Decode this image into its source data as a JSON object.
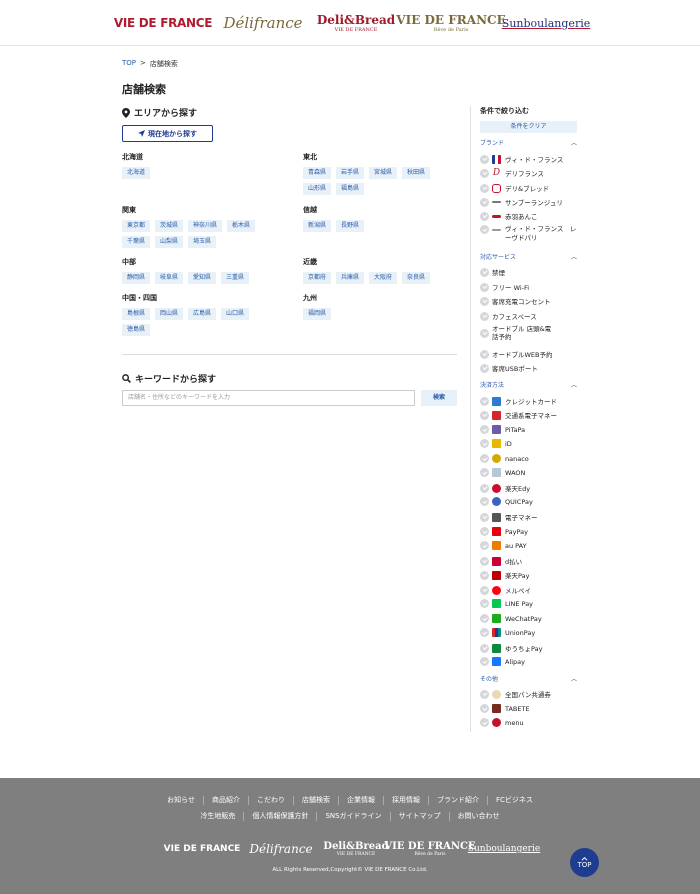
{
  "header": {
    "brands": [
      {
        "label": "VIE DE FRANCE"
      },
      {
        "label": "Délifrance"
      },
      {
        "label": "Deli&Bread",
        "sub": "VIE DE FRANCE"
      },
      {
        "label": "VIE DE FRANCE",
        "sub": "Rêve de Paris"
      },
      {
        "label": "Sunboulangerie"
      }
    ]
  },
  "breadcrumb": {
    "home": "TOP",
    "sep": ">",
    "current": "店舗検索"
  },
  "page_title": "店舗検索",
  "area": {
    "heading": "エリアから探す",
    "location_button": "現在地から探す",
    "regions": [
      {
        "name": "北海道",
        "prefs": [
          "北海道"
        ]
      },
      {
        "name": "東北",
        "prefs": [
          "青森県",
          "岩手県",
          "宮城県",
          "秋田県",
          "山形県",
          "福島県"
        ]
      },
      {
        "name": "関東",
        "prefs": [
          "東京都",
          "茨城県",
          "神奈川県",
          "栃木県",
          "千葉県",
          "山梨県",
          "埼玉県"
        ]
      },
      {
        "name": "信越",
        "prefs": [
          "新潟県",
          "長野県"
        ]
      },
      {
        "name": "中部",
        "prefs": [
          "静岡県",
          "岐阜県",
          "愛知県",
          "三重県"
        ]
      },
      {
        "name": "近畿",
        "prefs": [
          "京都府",
          "兵庫県",
          "大阪府",
          "奈良県"
        ]
      },
      {
        "name": "中国・四国",
        "prefs": [
          "島根県",
          "岡山県",
          "広島県",
          "山口県",
          "徳島県"
        ]
      },
      {
        "name": "九州",
        "prefs": [
          "福岡県"
        ]
      }
    ]
  },
  "keyword": {
    "heading": "キーワードから探す",
    "placeholder": "店舗名・住所などのキーワードを入力",
    "button": "検索"
  },
  "filter": {
    "title": "条件で絞り込む",
    "clear": "条件をクリア",
    "groups": [
      {
        "label": "ブランド",
        "items": [
          "ヴィ・ド・フランス",
          "デリフランス",
          "デリ&ブレッド",
          "サンブーランジュリ",
          "赤羽あんこ",
          "ヴィ・ド・フランス　レーヴドパリ"
        ]
      },
      {
        "label": "対応サービス",
        "items": [
          "禁煙",
          "フリー Wi-Fi",
          "客席充電コンセント",
          "カフェスペース",
          "オードブル 店頭&電話予約",
          "オードブルWEB予約",
          "客席USBポート"
        ]
      },
      {
        "label": "決済方法",
        "items": [
          "クレジットカード",
          "交通系電子マネー",
          "PiTaPa",
          "iD",
          "nanaco",
          "WAON",
          "楽天Edy",
          "QUICPay",
          "電子マネー",
          "PayPay",
          "au PAY",
          "d払い",
          "楽天Pay",
          "メルペイ",
          "LINE Pay",
          "WeChatPay",
          "UnionPay",
          "ゆうちょPay",
          "Alipay"
        ]
      },
      {
        "label": "その他",
        "items": [
          "全国パン共通券",
          "TABETE",
          "menu"
        ]
      }
    ]
  },
  "footer": {
    "nav1": [
      "お知らせ",
      "商品紹介",
      "こだわり",
      "店舗検索",
      "企業情報",
      "採用情報",
      "ブランド紹介",
      "FCビジネス"
    ],
    "nav2": [
      "冷生地販売",
      "個人情報保護方針",
      "SNSガイドライン",
      "サイトマップ",
      "お問い合わせ"
    ],
    "copyright": "ALL Rights Reserved,Copyright© VIE DE FRANCE Co.Ltd.",
    "top_button": "TOP"
  },
  "colors": {
    "accent": "#1e3d8f",
    "link": "#2a5aa8",
    "chip_bg": "#e8f1f8",
    "footer_bg": "#7f7f7f"
  }
}
